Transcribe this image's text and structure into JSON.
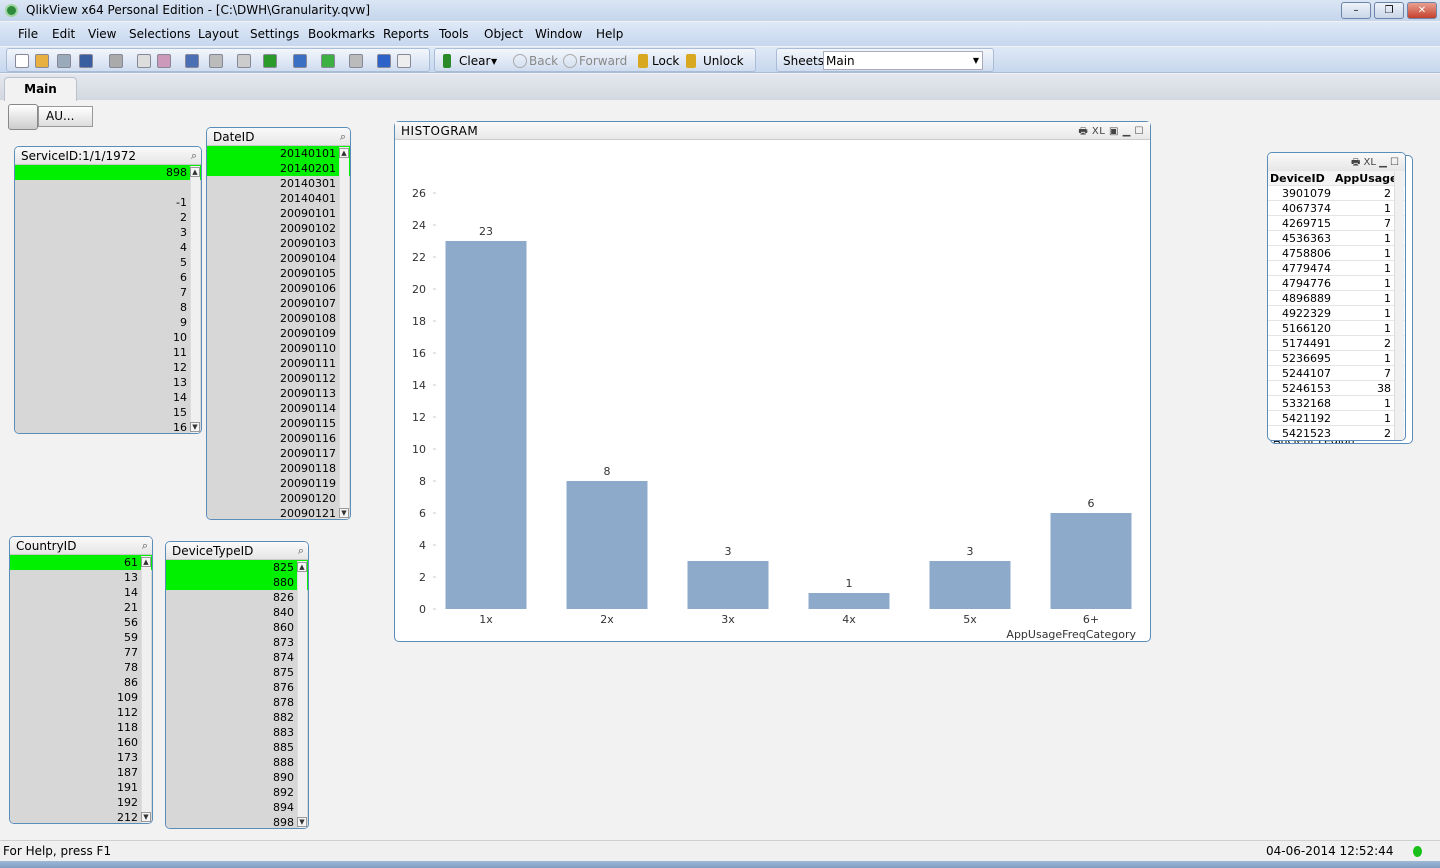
{
  "window": {
    "title": "QlikView x64 Personal Edition - [C:\\DWH\\Granularity.qvw]"
  },
  "menu": [
    "File",
    "Edit",
    "View",
    "Selections",
    "Layout",
    "Settings",
    "Bookmarks",
    "Reports",
    "Tools",
    "Object",
    "Window",
    "Help"
  ],
  "toolbar": {
    "clear": "Clear",
    "back": "Back",
    "forward": "Forward",
    "lock": "Lock",
    "unlock": "Unlock",
    "sheets_label": "Sheets",
    "sheets_value": "Main"
  },
  "tabs": [
    {
      "label": "Main",
      "active": true
    }
  ],
  "sheet_object_button": "AU...",
  "listboxes": {
    "service": {
      "title": "ServiceID:1/1/1972",
      "items": [
        "898",
        "",
        "-1",
        "2",
        "3",
        "4",
        "5",
        "6",
        "7",
        "8",
        "9",
        "10",
        "11",
        "12",
        "13",
        "14",
        "15",
        "16"
      ],
      "selected": [
        "898"
      ]
    },
    "date": {
      "title": "DateID",
      "items": [
        "20140101",
        "20140201",
        "20140301",
        "20140401",
        "20090101",
        "20090102",
        "20090103",
        "20090104",
        "20090105",
        "20090106",
        "20090107",
        "20090108",
        "20090109",
        "20090110",
        "20090111",
        "20090112",
        "20090113",
        "20090114",
        "20090115",
        "20090116",
        "20090117",
        "20090118",
        "20090119",
        "20090120",
        "20090121"
      ],
      "selected": [
        "20140101",
        "20140201"
      ]
    },
    "country": {
      "title": "CountryID",
      "items": [
        "61",
        "13",
        "14",
        "21",
        "56",
        "59",
        "77",
        "78",
        "86",
        "109",
        "112",
        "118",
        "160",
        "173",
        "187",
        "191",
        "192",
        "212"
      ],
      "selected": [
        "61"
      ]
    },
    "devicetype": {
      "title": "DeviceTypeID",
      "items": [
        "825",
        "880",
        "826",
        "840",
        "860",
        "873",
        "874",
        "875",
        "876",
        "878",
        "882",
        "883",
        "885",
        "888",
        "890",
        "892",
        "894",
        "898"
      ],
      "selected": [
        "825",
        "880"
      ]
    }
  },
  "chart_data": {
    "type": "bar",
    "title": "HISTOGRAM",
    "xlabel": "AppUsageFreqCategory",
    "ylabel": "",
    "categories": [
      "1x",
      "2x",
      "3x",
      "4x",
      "5x",
      "6+"
    ],
    "values": [
      23,
      8,
      3,
      1,
      3,
      6
    ],
    "ylim": [
      0,
      26
    ],
    "yticks": [
      0,
      2,
      4,
      6,
      8,
      10,
      12,
      14,
      16,
      18,
      20,
      22,
      24,
      26
    ],
    "bar_color": "#8eaacb",
    "grid": false,
    "data_labels": true
  },
  "table": {
    "columns": [
      "DeviceID",
      "AppUsage"
    ],
    "rows": [
      [
        "3901079",
        "2"
      ],
      [
        "4067374",
        "1"
      ],
      [
        "4269715",
        "7"
      ],
      [
        "4536363",
        "1"
      ],
      [
        "4758806",
        "1"
      ],
      [
        "4779474",
        "1"
      ],
      [
        "4794776",
        "1"
      ],
      [
        "4896889",
        "1"
      ],
      [
        "4922329",
        "1"
      ],
      [
        "5166120",
        "1"
      ],
      [
        "5174491",
        "2"
      ],
      [
        "5236695",
        "1"
      ],
      [
        "5244107",
        "7"
      ],
      [
        "5246153",
        "38"
      ],
      [
        "5332168",
        "1"
      ],
      [
        "5421192",
        "1"
      ],
      [
        "5421523",
        "2"
      ]
    ],
    "behind_text": "Ancient Legion"
  },
  "status": {
    "help": "For Help, press F1",
    "datetime": "04-06-2014 12:52:44"
  },
  "colors": {
    "selected": "#00f000",
    "possible": "#ffffff",
    "excluded": "#d7d7d7",
    "border": "#5b8dbb"
  }
}
